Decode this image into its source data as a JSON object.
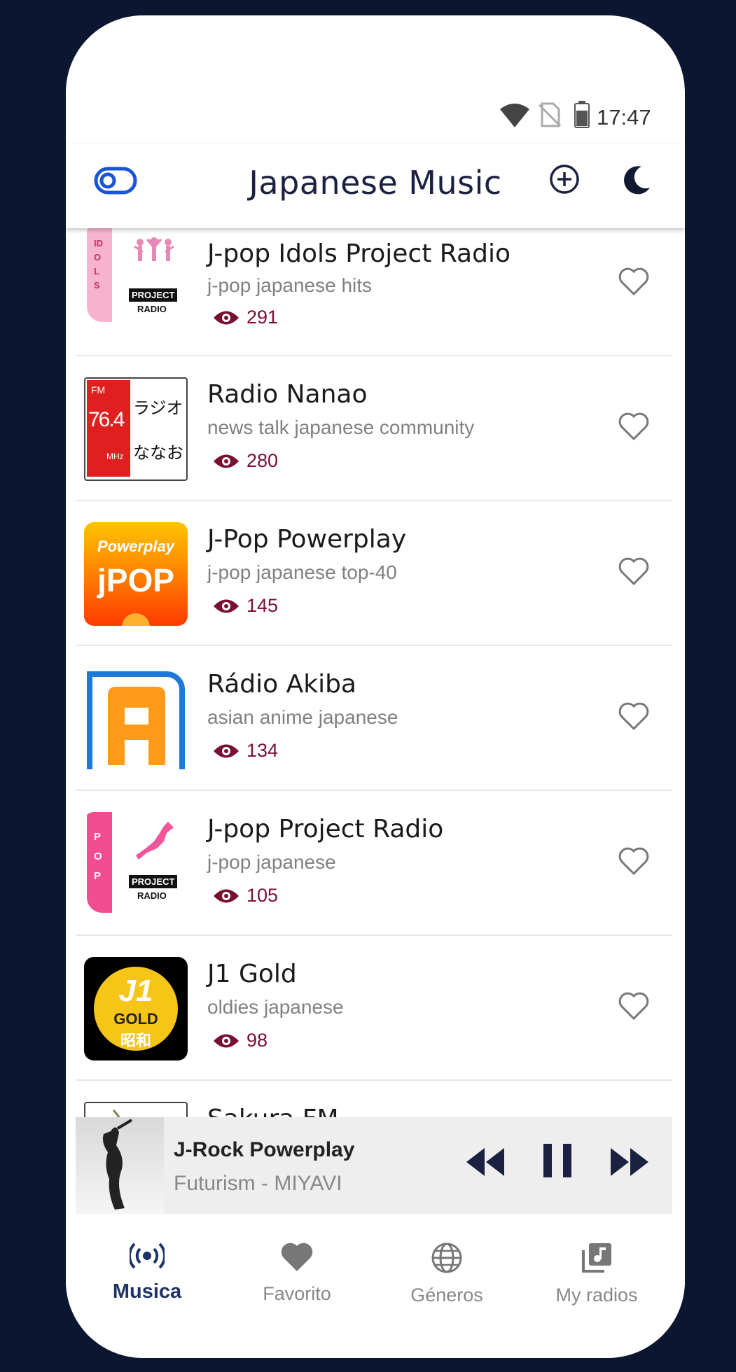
{
  "status": {
    "time": "17:47"
  },
  "app_bar": {
    "title": "Japanese Music"
  },
  "stations": [
    {
      "name": "J-pop Idols Project Radio",
      "tags": "j-pop japanese hits",
      "views": "291"
    },
    {
      "name": "Radio Nanao",
      "tags": "news talk japanese community",
      "views": "280"
    },
    {
      "name": "J-Pop Powerplay",
      "tags": "j-pop japanese top-40",
      "views": "145"
    },
    {
      "name": "Rádio Akiba",
      "tags": "asian anime japanese",
      "views": "134"
    },
    {
      "name": "J-pop Project Radio",
      "tags": "j-pop japanese",
      "views": "105"
    },
    {
      "name": "J1 Gold",
      "tags": "oldies japanese",
      "views": "98"
    },
    {
      "name": "Sakura FM",
      "tags": "",
      "views": ""
    }
  ],
  "logos": {
    "idols": {
      "vertical": "IDOLS",
      "badge": "PROJECT",
      "sub": "RADIO"
    },
    "nanao": {
      "fm": "FM",
      "freq": "76.4",
      "mhz": "MHz",
      "jp1": "ラジオ",
      "jp2": "ななお"
    },
    "powerplay": {
      "top": "Powerplay",
      "main": "jPOP"
    },
    "akiba": {
      "letter": "A"
    },
    "pop": {
      "vertical": "POP",
      "badge": "PROJECT",
      "sub": "RADIO"
    },
    "gold": {
      "j1": "J1",
      "gold": "GOLD",
      "showa": "昭和"
    }
  },
  "now_playing": {
    "station": "J-Rock Powerplay",
    "track": "Futurism - MIYAVI"
  },
  "nav": [
    {
      "label": "Musica",
      "icon": "radio-icon",
      "active": true
    },
    {
      "label": "Favorito",
      "icon": "heart-icon",
      "active": false
    },
    {
      "label": "Géneros",
      "icon": "globe-icon",
      "active": false
    },
    {
      "label": "My radios",
      "icon": "music-library-icon",
      "active": false
    }
  ],
  "colors": {
    "accent": "#1e3366",
    "views": "#7a1030",
    "toggle": "#1a55d8",
    "background": "#0b1631"
  }
}
